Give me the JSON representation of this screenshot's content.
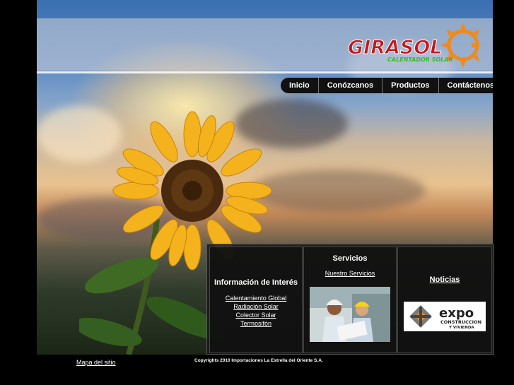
{
  "brand": {
    "name": "GIRASOL",
    "tagline": "CALENTADOR SOLAR"
  },
  "nav": {
    "items": [
      "Inicio",
      "Conózcanos",
      "Productos",
      "Contáctenos"
    ]
  },
  "panels": {
    "info": {
      "title": "Información de Interés",
      "links": [
        "Calentamiento Global",
        "Radiación Solar",
        "Colector Solar",
        "Termosifón"
      ]
    },
    "services": {
      "title": "Servicios",
      "link": "Nuestro Servicios"
    },
    "news": {
      "title": "Noticias",
      "expo_logo": {
        "word": "expo",
        "line1": "CONSTRUCCION",
        "line2": "Y VIVIENDA"
      }
    }
  },
  "footer": {
    "sitemap": "Mapa del sitio",
    "copyright": "Copyrights 2010 Importaciones La Estrella del Oriente S.A."
  },
  "colors": {
    "accent_orange": "#f08a1c",
    "brand_red": "#c8151b",
    "tagline_green": "#3cba2a",
    "nav_bg": "#111111"
  }
}
